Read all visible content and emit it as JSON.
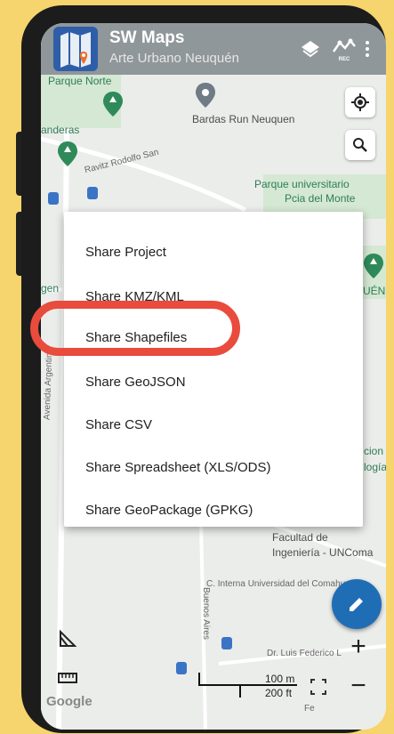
{
  "app": {
    "title": "SW Maps",
    "subtitle": "Arte Urbano Neuquén"
  },
  "map_labels": {
    "parque_norte": "Parque Norte",
    "bardas": "Bardas Run Neuquen",
    "banderas": "anderas",
    "street_ravitz": "Ravitz Rodolfo San",
    "parque_univ_1": "Parque universitario",
    "parque_univ_2": "Pcia del Monte",
    "gen": "gen",
    "uen": "UÉN",
    "avenida": "Avenida Argentina",
    "cion": "cion",
    "logia": "logía",
    "facultad_1": "Facultad de",
    "facultad_2": "Ingeniería - UNComa",
    "c_interna": "C. Interna Universidad del Comahue",
    "buenos_aires": "Buenos Aires",
    "dr_luis": "Dr. Luis Federico L",
    "fe": "Fe",
    "google": "Google"
  },
  "menu": {
    "items": [
      "Share Project",
      "Share KMZ/KML",
      "Share Shapefiles",
      "Share GeoJSON",
      "Share CSV",
      "Share Spreadsheet (XLS/ODS)",
      "Share GeoPackage (GPKG)"
    ],
    "highlighted_index": 2
  },
  "scale": {
    "metric": "100 m",
    "imperial": "200 ft"
  },
  "controls": {
    "zoom_in": "+",
    "zoom_out": "−",
    "rec_label": "REC"
  },
  "icons": {
    "layers": "layers-icon",
    "rec": "rec-icon",
    "more": "more-vert-icon",
    "location": "my-location-icon",
    "search": "search-icon",
    "measure": "measure-angle-icon",
    "ruler": "ruler-icon",
    "fullscreen": "fullscreen-icon",
    "edit": "edit-pencil-icon"
  },
  "colors": {
    "background": "#F6D56E",
    "highlight": "#E94B3C",
    "fab": "#1F6EB5",
    "park_pin": "#2f8a5a"
  }
}
